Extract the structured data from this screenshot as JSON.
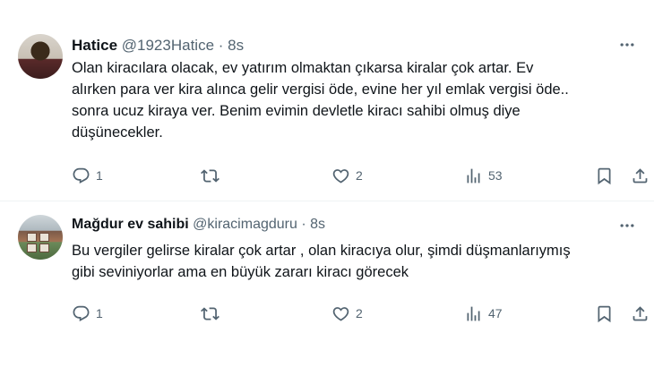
{
  "tweets": [
    {
      "name": "Hatice",
      "handle": "@1923Hatice",
      "time": "· 8s",
      "text": "Olan kiracılara olacak, ev yatırım olmaktan çıkarsa  kiralar çok artar. Ev\nalırken para ver kira alınca gelir vergisi öde, evine her yıl emlak vergisi öde..\nsonra ucuz kiraya ver. Benim evimin devletle kiracı sahibi olmuş diye\ndüşünecekler.",
      "replies": "1",
      "retweets": "",
      "likes": "2",
      "views": "53"
    },
    {
      "name": "Mağdur ev sahibi",
      "handle": "@kiracimagduru",
      "time": "· 8s",
      "text": "Bu vergiler gelirse kiralar çok artar , olan kiracıya olur, şimdi düşmanlarıymış\ngibi seviniyorlar ama en büyük zararı kiracı görecek",
      "replies": "1",
      "retweets": "",
      "likes": "2",
      "views": "47"
    }
  ],
  "icons": {
    "more": "more-icon",
    "reply": "reply-icon",
    "retweet": "retweet-icon",
    "like": "heart-icon",
    "views": "views-icon",
    "bookmark": "bookmark-icon",
    "share": "share-icon"
  },
  "colors": {
    "text": "#0f1419",
    "secondary": "#536471",
    "divider": "#eff3f4"
  }
}
